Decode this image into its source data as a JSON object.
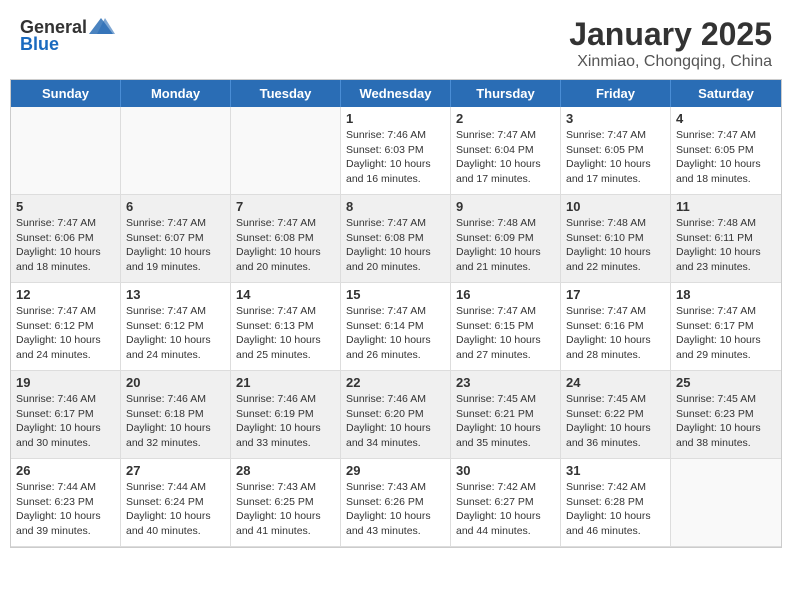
{
  "header": {
    "logo_general": "General",
    "logo_blue": "Blue",
    "title": "January 2025",
    "subtitle": "Xinmiao, Chongqing, China"
  },
  "days": [
    "Sunday",
    "Monday",
    "Tuesday",
    "Wednesday",
    "Thursday",
    "Friday",
    "Saturday"
  ],
  "cells": [
    {
      "date": "",
      "info": "",
      "empty": true
    },
    {
      "date": "",
      "info": "",
      "empty": true
    },
    {
      "date": "",
      "info": "",
      "empty": true
    },
    {
      "date": "1",
      "info": "Sunrise: 7:46 AM\nSunset: 6:03 PM\nDaylight: 10 hours\nand 16 minutes."
    },
    {
      "date": "2",
      "info": "Sunrise: 7:47 AM\nSunset: 6:04 PM\nDaylight: 10 hours\nand 17 minutes."
    },
    {
      "date": "3",
      "info": "Sunrise: 7:47 AM\nSunset: 6:05 PM\nDaylight: 10 hours\nand 17 minutes."
    },
    {
      "date": "4",
      "info": "Sunrise: 7:47 AM\nSunset: 6:05 PM\nDaylight: 10 hours\nand 18 minutes."
    },
    {
      "date": "5",
      "info": "Sunrise: 7:47 AM\nSunset: 6:06 PM\nDaylight: 10 hours\nand 18 minutes.",
      "shaded": true
    },
    {
      "date": "6",
      "info": "Sunrise: 7:47 AM\nSunset: 6:07 PM\nDaylight: 10 hours\nand 19 minutes.",
      "shaded": true
    },
    {
      "date": "7",
      "info": "Sunrise: 7:47 AM\nSunset: 6:08 PM\nDaylight: 10 hours\nand 20 minutes.",
      "shaded": true
    },
    {
      "date": "8",
      "info": "Sunrise: 7:47 AM\nSunset: 6:08 PM\nDaylight: 10 hours\nand 20 minutes.",
      "shaded": true
    },
    {
      "date": "9",
      "info": "Sunrise: 7:48 AM\nSunset: 6:09 PM\nDaylight: 10 hours\nand 21 minutes.",
      "shaded": true
    },
    {
      "date": "10",
      "info": "Sunrise: 7:48 AM\nSunset: 6:10 PM\nDaylight: 10 hours\nand 22 minutes.",
      "shaded": true
    },
    {
      "date": "11",
      "info": "Sunrise: 7:48 AM\nSunset: 6:11 PM\nDaylight: 10 hours\nand 23 minutes.",
      "shaded": true
    },
    {
      "date": "12",
      "info": "Sunrise: 7:47 AM\nSunset: 6:12 PM\nDaylight: 10 hours\nand 24 minutes."
    },
    {
      "date": "13",
      "info": "Sunrise: 7:47 AM\nSunset: 6:12 PM\nDaylight: 10 hours\nand 24 minutes."
    },
    {
      "date": "14",
      "info": "Sunrise: 7:47 AM\nSunset: 6:13 PM\nDaylight: 10 hours\nand 25 minutes."
    },
    {
      "date": "15",
      "info": "Sunrise: 7:47 AM\nSunset: 6:14 PM\nDaylight: 10 hours\nand 26 minutes."
    },
    {
      "date": "16",
      "info": "Sunrise: 7:47 AM\nSunset: 6:15 PM\nDaylight: 10 hours\nand 27 minutes."
    },
    {
      "date": "17",
      "info": "Sunrise: 7:47 AM\nSunset: 6:16 PM\nDaylight: 10 hours\nand 28 minutes."
    },
    {
      "date": "18",
      "info": "Sunrise: 7:47 AM\nSunset: 6:17 PM\nDaylight: 10 hours\nand 29 minutes."
    },
    {
      "date": "19",
      "info": "Sunrise: 7:46 AM\nSunset: 6:17 PM\nDaylight: 10 hours\nand 30 minutes.",
      "shaded": true
    },
    {
      "date": "20",
      "info": "Sunrise: 7:46 AM\nSunset: 6:18 PM\nDaylight: 10 hours\nand 32 minutes.",
      "shaded": true
    },
    {
      "date": "21",
      "info": "Sunrise: 7:46 AM\nSunset: 6:19 PM\nDaylight: 10 hours\nand 33 minutes.",
      "shaded": true
    },
    {
      "date": "22",
      "info": "Sunrise: 7:46 AM\nSunset: 6:20 PM\nDaylight: 10 hours\nand 34 minutes.",
      "shaded": true
    },
    {
      "date": "23",
      "info": "Sunrise: 7:45 AM\nSunset: 6:21 PM\nDaylight: 10 hours\nand 35 minutes.",
      "shaded": true
    },
    {
      "date": "24",
      "info": "Sunrise: 7:45 AM\nSunset: 6:22 PM\nDaylight: 10 hours\nand 36 minutes.",
      "shaded": true
    },
    {
      "date": "25",
      "info": "Sunrise: 7:45 AM\nSunset: 6:23 PM\nDaylight: 10 hours\nand 38 minutes.",
      "shaded": true
    },
    {
      "date": "26",
      "info": "Sunrise: 7:44 AM\nSunset: 6:23 PM\nDaylight: 10 hours\nand 39 minutes."
    },
    {
      "date": "27",
      "info": "Sunrise: 7:44 AM\nSunset: 6:24 PM\nDaylight: 10 hours\nand 40 minutes."
    },
    {
      "date": "28",
      "info": "Sunrise: 7:43 AM\nSunset: 6:25 PM\nDaylight: 10 hours\nand 41 minutes."
    },
    {
      "date": "29",
      "info": "Sunrise: 7:43 AM\nSunset: 6:26 PM\nDaylight: 10 hours\nand 43 minutes."
    },
    {
      "date": "30",
      "info": "Sunrise: 7:42 AM\nSunset: 6:27 PM\nDaylight: 10 hours\nand 44 minutes."
    },
    {
      "date": "31",
      "info": "Sunrise: 7:42 AM\nSunset: 6:28 PM\nDaylight: 10 hours\nand 46 minutes."
    },
    {
      "date": "",
      "info": "",
      "empty": true
    }
  ]
}
